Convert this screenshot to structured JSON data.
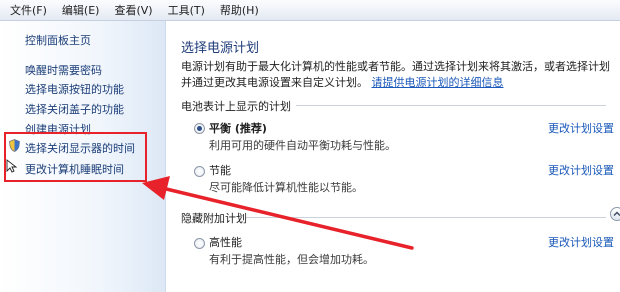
{
  "menu": {
    "items": [
      {
        "label": "文件(F)"
      },
      {
        "label": "编辑(E)"
      },
      {
        "label": "查看(V)"
      },
      {
        "label": "工具(T)"
      },
      {
        "label": "帮助(H)"
      }
    ]
  },
  "sidebar": {
    "home": "控制面板主页",
    "links": [
      {
        "label": "唤醒时需要密码"
      },
      {
        "label": "选择电源按钮的功能"
      },
      {
        "label": "选择关闭盖子的功能"
      },
      {
        "label": "创建电源计划"
      },
      {
        "label": "选择关闭显示器的时间"
      },
      {
        "label": "更改计算机睡眠时间"
      }
    ]
  },
  "main": {
    "title": "选择电源计划",
    "intro_text": "电源计划有助于最大化计算机的性能或者节能。通过选择计划来将其激活，或者选择计划并通过更改其电源设置来自定义计划。",
    "intro_link": "请提供电源计划的详细信息",
    "section_battery": "电池表计上显示的计划",
    "section_hidden": "隐藏附加计划",
    "plans": [
      {
        "name": "平衡 (推荐)",
        "desc": "利用可用的硬件自动平衡功耗与性能。",
        "link": "更改计划设置",
        "selected": true
      },
      {
        "name": "节能",
        "desc": "尽可能降低计算机性能以节能。",
        "link": "更改计划设置",
        "selected": false
      },
      {
        "name": "高性能",
        "desc": "有利于提高性能，但会增加功耗。",
        "link": "更改计划设置",
        "selected": false
      }
    ]
  },
  "colors": {
    "annotation": "#e8222a",
    "link": "#1a58b9",
    "title": "#1f3c7a"
  }
}
